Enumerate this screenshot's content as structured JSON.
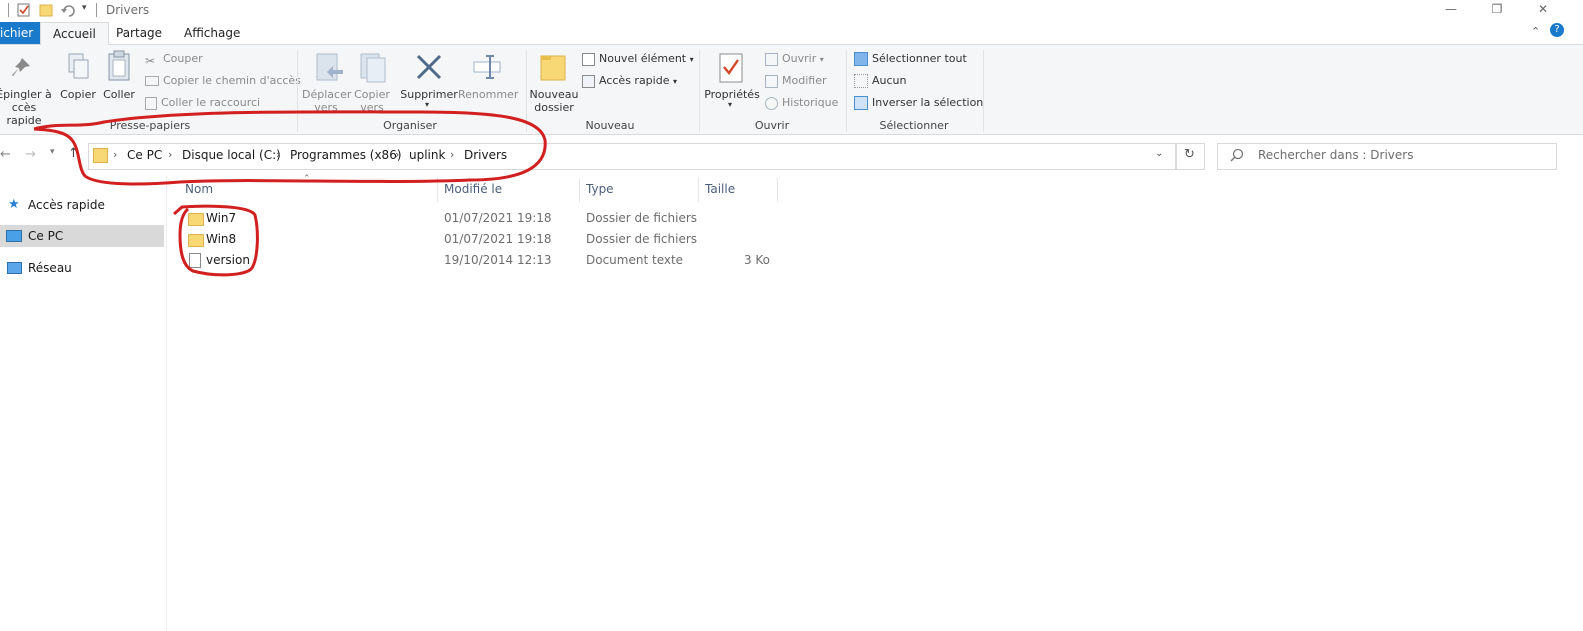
{
  "window": {
    "title": "Drivers",
    "minimize": "—",
    "maximize": "❐",
    "close": "✕"
  },
  "tabs": [
    {
      "label": "ichier"
    },
    {
      "label": "Accueil"
    },
    {
      "label": "Partage"
    },
    {
      "label": "Affichage"
    }
  ],
  "ribbon": {
    "pin_line1": "Épingler à",
    "pin_line2": "ccès rapide",
    "copy": "Copier",
    "paste": "Coller",
    "cut": "Couper",
    "copy_path": "Copier le chemin d'accès",
    "paste_shortcut": "Coller le raccourci",
    "group_clipboard": "Presse-papiers",
    "move_line1": "Déplacer",
    "move_line2": "vers",
    "copyto_line1": "Copier",
    "copyto_line2": "vers",
    "delete": "Supprimer",
    "rename": "Renommer",
    "group_organize": "Organiser",
    "new_folder_line1": "Nouveau",
    "new_folder_line2": "dossier",
    "new_item": "Nouvel élément",
    "quick_access": "Accès rapide",
    "group_new": "Nouveau",
    "properties": "Propriétés",
    "open": "Ouvrir",
    "edit": "Modifier",
    "history": "Historique",
    "group_open": "Ouvrir",
    "select_all": "Sélectionner tout",
    "select_none": "Aucun",
    "invert_selection": "Inverser la sélection",
    "group_select": "Sélectionner"
  },
  "address": {
    "crumbs": [
      "Ce PC",
      "Disque local (C:)",
      "Programmes (x86)",
      "uplink",
      "Drivers"
    ],
    "search_placeholder": "Rechercher dans : Drivers"
  },
  "nav": [
    {
      "label": "Accès rapide"
    },
    {
      "label": "Ce PC"
    },
    {
      "label": "Réseau"
    }
  ],
  "list": {
    "columns": [
      "Nom",
      "Modifié le",
      "Type",
      "Taille"
    ],
    "rows": [
      {
        "name": "Win7",
        "modified": "01/07/2021 19:18",
        "type": "Dossier de fichiers",
        "size": ""
      },
      {
        "name": "Win8",
        "modified": "01/07/2021 19:18",
        "type": "Dossier de fichiers",
        "size": ""
      },
      {
        "name": "version",
        "modified": "19/10/2014 12:13",
        "type": "Document texte",
        "size": "3 Ko"
      }
    ]
  },
  "colors": {
    "file_tab": "#1979ca",
    "annotation": "#d21f1f",
    "folder": "#f8d775"
  }
}
